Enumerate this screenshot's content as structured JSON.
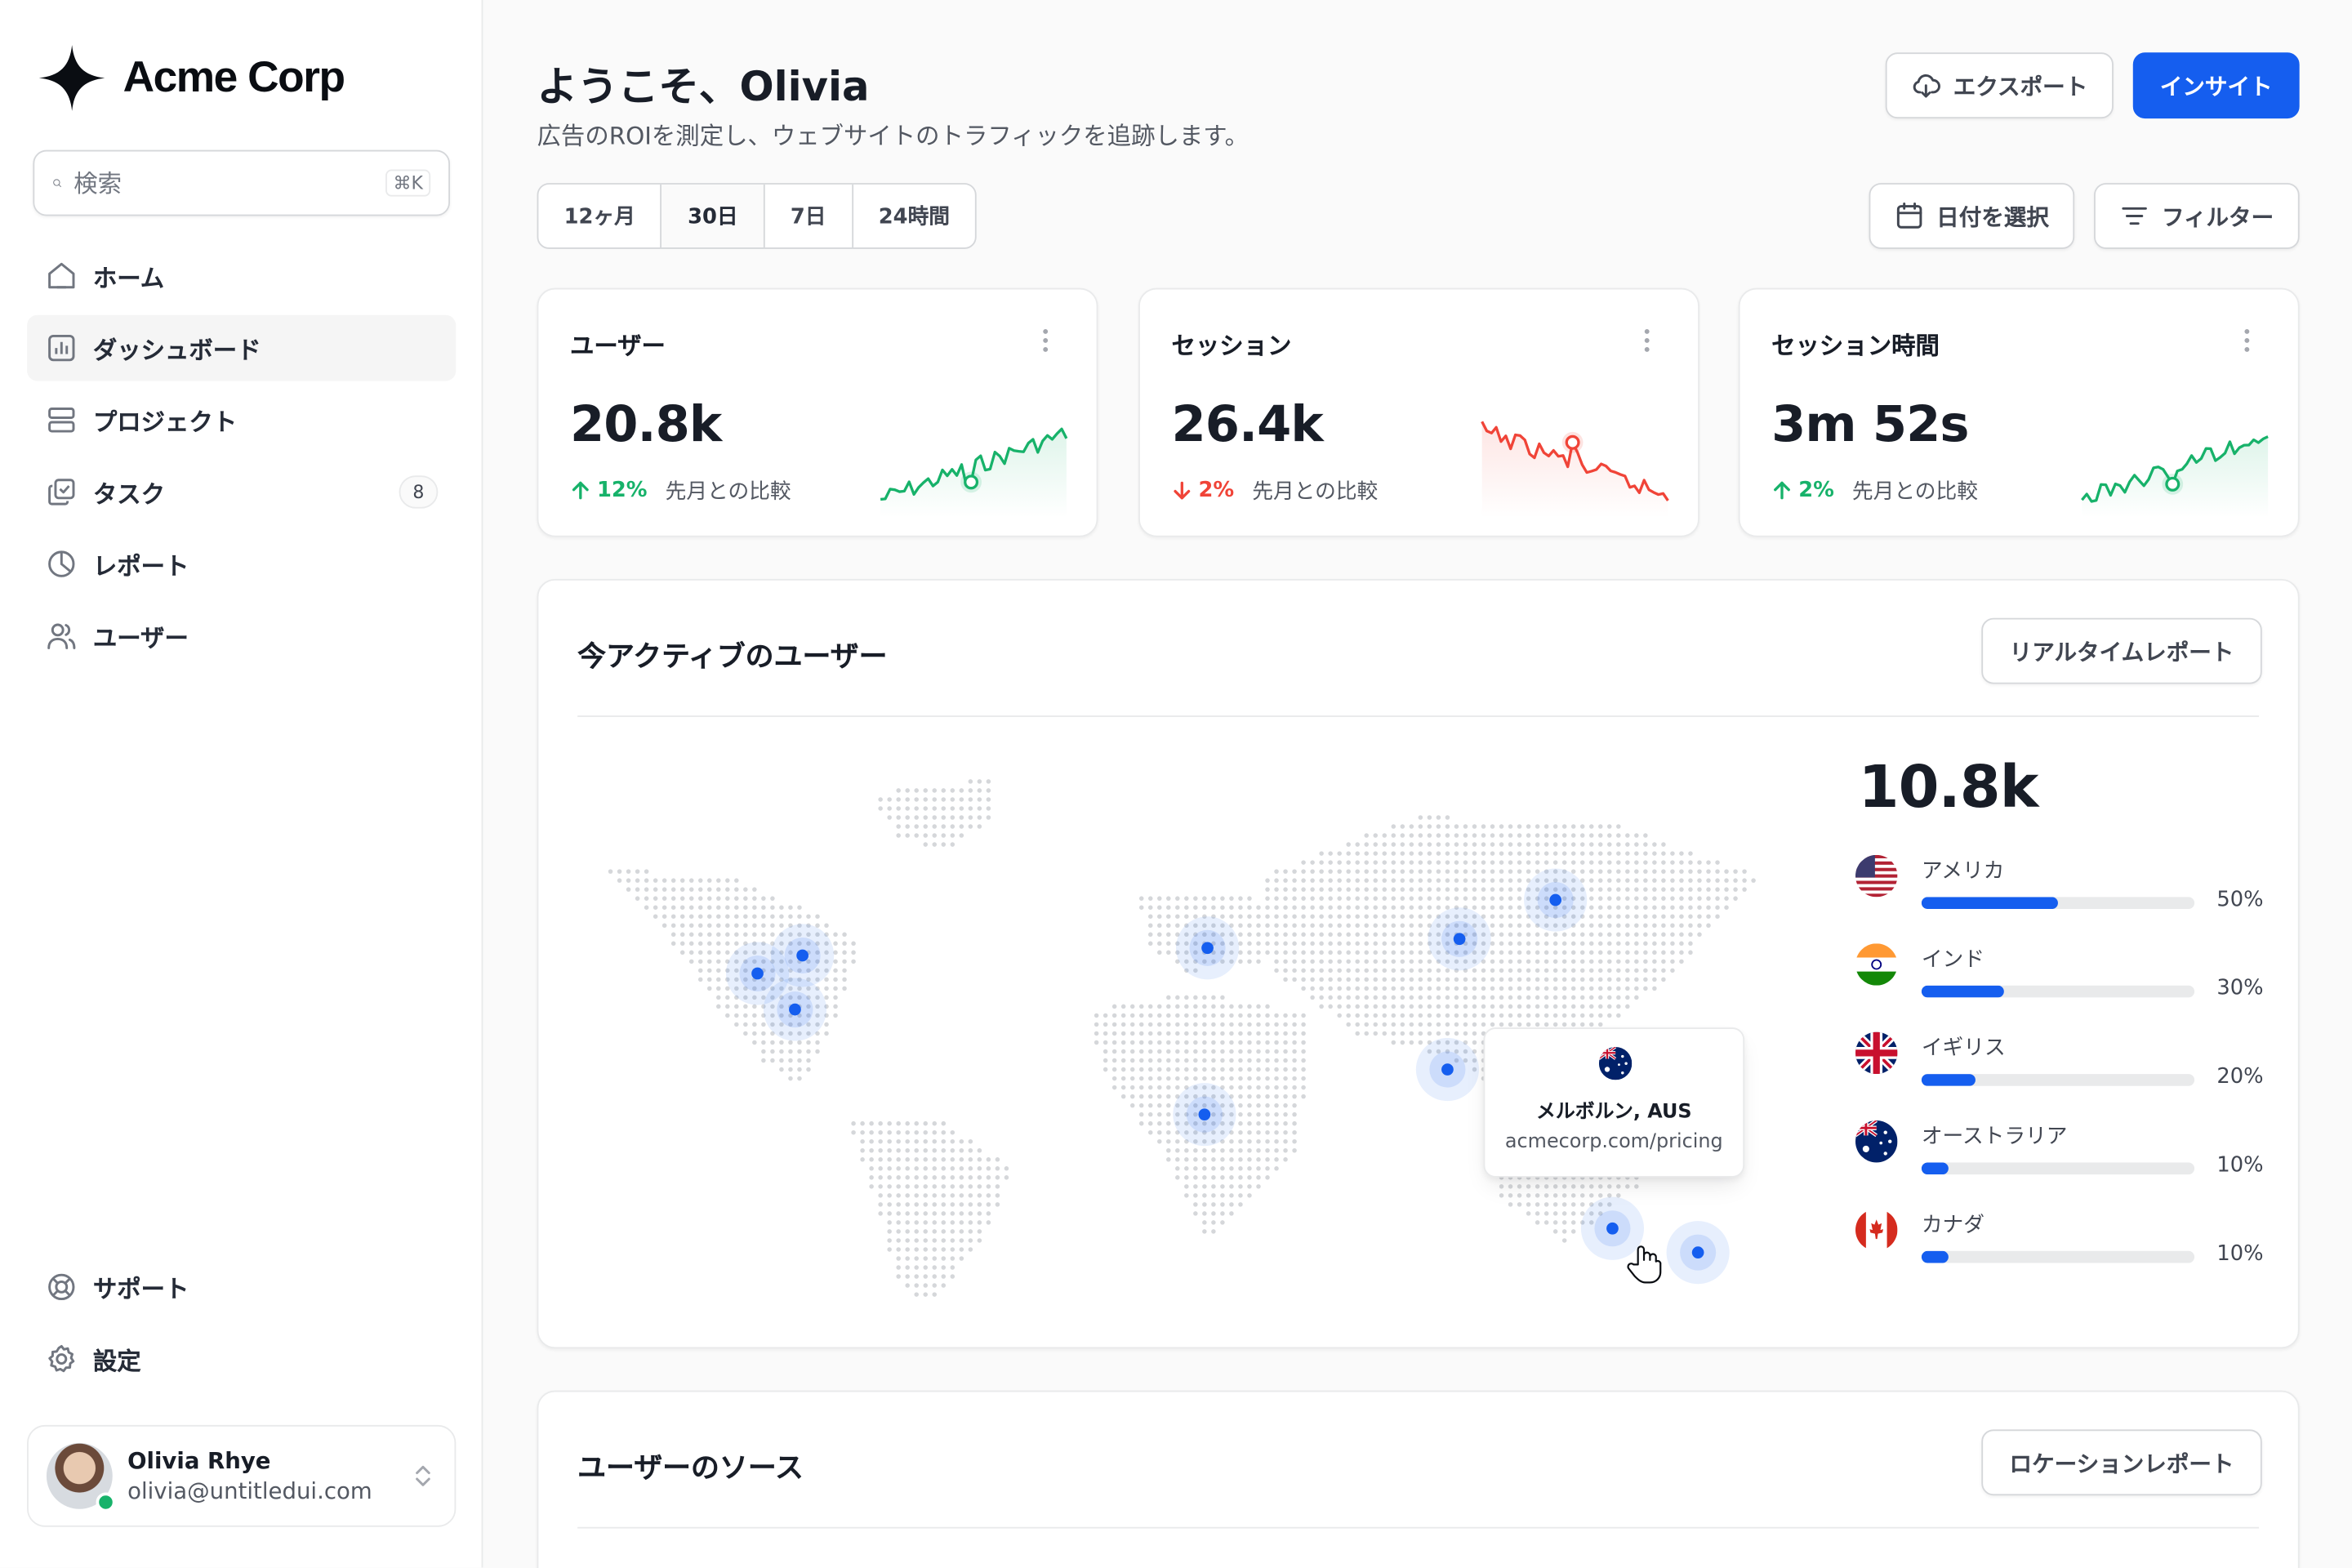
{
  "app": {
    "name": "Acme Corp"
  },
  "search": {
    "placeholder": "検索",
    "shortcut": "⌘K"
  },
  "sidebar": {
    "items": [
      {
        "label": "ホーム",
        "icon": "home-icon"
      },
      {
        "label": "ダッシュボード",
        "icon": "bar-chart-icon",
        "active": true
      },
      {
        "label": "プロジェクト",
        "icon": "layers-icon"
      },
      {
        "label": "タスク",
        "icon": "check-square-icon",
        "badge": "8"
      },
      {
        "label": "レポート",
        "icon": "pie-chart-icon"
      },
      {
        "label": "ユーザー",
        "icon": "users-icon"
      }
    ],
    "bottom": [
      {
        "label": "サポート",
        "icon": "life-buoy-icon"
      },
      {
        "label": "設定",
        "icon": "gear-icon"
      }
    ]
  },
  "user": {
    "name": "Olivia Rhye",
    "email": "olivia@untitledui.com",
    "status": "online"
  },
  "header": {
    "title": "ようこそ、Olivia",
    "subtitle": "広告のROIを測定し、ウェブサイトのトラフィックを追跡します。",
    "export_label": "エクスポート",
    "insight_label": "インサイト"
  },
  "ranges": [
    {
      "label": "12ヶ月"
    },
    {
      "label": "30日",
      "active": true
    },
    {
      "label": "7日"
    },
    {
      "label": "24時間"
    }
  ],
  "date_label": "日付を選択",
  "filter_label": "フィルター",
  "metrics": [
    {
      "title": "ユーザー",
      "value": "20.8k",
      "change": "12%",
      "direction": "up",
      "compare": "先月との比較",
      "color": "#17b26a"
    },
    {
      "title": "セッション",
      "value": "26.4k",
      "change": "2%",
      "direction": "down",
      "compare": "先月との比較",
      "color": "#f04438"
    },
    {
      "title": "セッション時間",
      "value": "3m 52s",
      "change": "2%",
      "direction": "up",
      "compare": "先月との比較",
      "color": "#17b26a"
    }
  ],
  "active_users": {
    "title": "今アクティブのユーザー",
    "report_label": "リアルタイムレポート",
    "total": "10.8k",
    "countries": [
      {
        "name": "アメリカ",
        "percent": 50,
        "label": "50%",
        "flag": "us-flag-icon"
      },
      {
        "name": "インド",
        "percent": 30,
        "label": "30%",
        "flag": "india-flag-icon"
      },
      {
        "name": "イギリス",
        "percent": 20,
        "label": "20%",
        "flag": "uk-flag-icon"
      },
      {
        "name": "オーストラリア",
        "percent": 10,
        "label": "10%",
        "flag": "australia-flag-icon"
      },
      {
        "name": "カナダ",
        "percent": 10,
        "label": "10%",
        "flag": "canada-flag-icon"
      }
    ],
    "tooltip": {
      "city": "メルボルン, AUS",
      "url": "acmecorp.com/pricing"
    }
  },
  "sources": {
    "title": "ユーザーのソース",
    "report_label": "ロケーションレポート"
  },
  "colors": {
    "accent": "#155eef",
    "success": "#17b26a",
    "error": "#f04438"
  }
}
